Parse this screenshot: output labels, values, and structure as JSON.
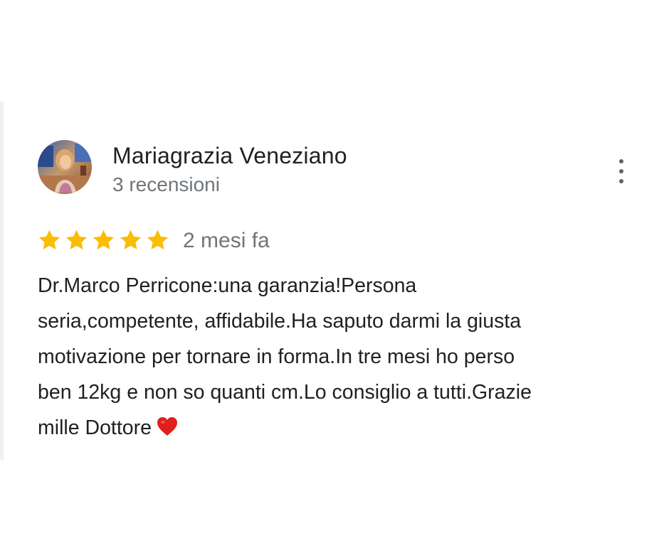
{
  "reviewer": {
    "name": "Mariagrazia Veneziano",
    "reviews_count": "3 recensioni"
  },
  "rating": {
    "stars": 5,
    "max": 5,
    "color": "#fbbc04"
  },
  "date": "2 mesi fa",
  "review": {
    "lines": [
      "Dr.Marco Perricone:una garanzia!Persona",
      "seria,competente, affidabile.Ha saputo darmi la giusta",
      "motivazione per tornare in forma.In tre mesi ho perso",
      "ben 12kg e non so quanti cm.Lo consiglio a tutti.Grazie",
      "mille Dottore"
    ],
    "emoji": "red-heart-icon"
  },
  "icons": {
    "menu": "more-vert-icon",
    "star": "star-icon"
  }
}
